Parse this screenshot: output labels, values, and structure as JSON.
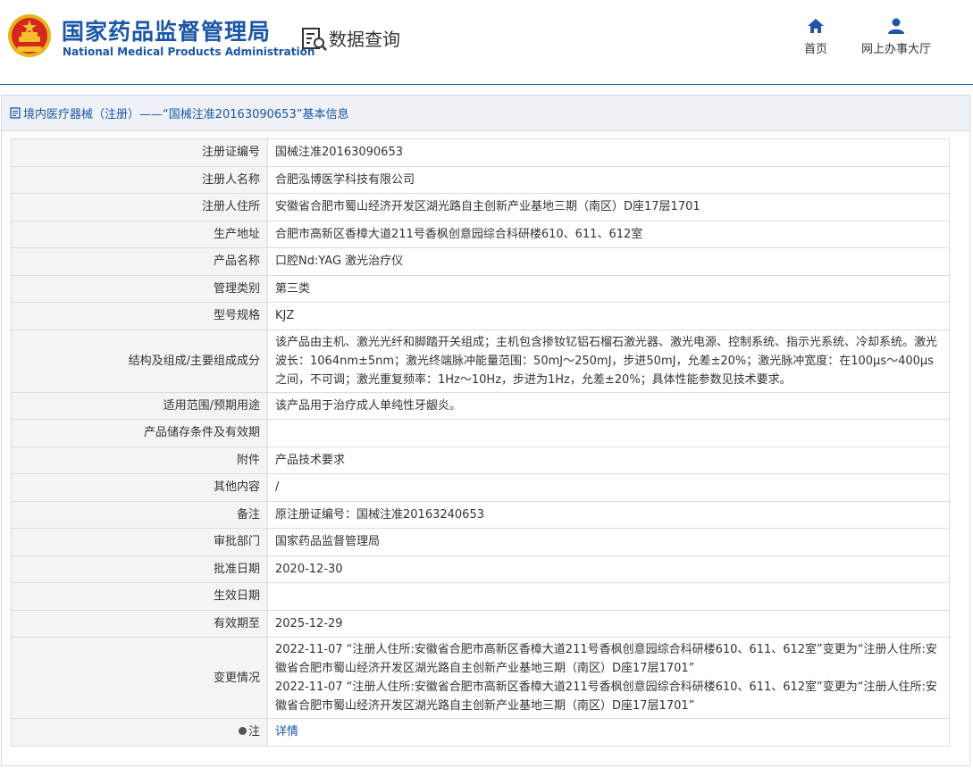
{
  "header": {
    "org_name_cn": "国家药品监督管理局",
    "org_name_en": "National Medical Products Administration",
    "page_title": "数据查询",
    "nav": [
      {
        "label": "首页",
        "icon": "home-icon"
      },
      {
        "label": "网上办事大厅",
        "icon": "user-icon"
      }
    ]
  },
  "panel": {
    "title": "境内医疗器械（注册）——“国械注准20163090653”基本信息"
  },
  "rows": [
    {
      "label": "注册证编号",
      "value": "国械注准20163090653"
    },
    {
      "label": "注册人名称",
      "value": "合肥泓博医学科技有限公司"
    },
    {
      "label": "注册人住所",
      "value": "安徽省合肥市蜀山经济开发区湖光路自主创新产业基地三期（南区）D座17层1701"
    },
    {
      "label": "生产地址",
      "value": "合肥市高新区香樟大道211号香枫创意园综合科研楼610、611、612室"
    },
    {
      "label": "产品名称",
      "value": "口腔Nd:YAG 激光治疗仪"
    },
    {
      "label": "管理类别",
      "value": "第三类"
    },
    {
      "label": "型号规格",
      "value": "KJZ"
    },
    {
      "label": "结构及组成/主要组成成分",
      "value": "该产品由主机、激光光纤和脚踏开关组成；主机包含掺钕钇铝石榴石激光器、激光电源、控制系统、指示光系统、冷却系统。激光波长：1064nm±5nm；激光终端脉冲能量范围：50mJ～250mJ，步进50mJ，允差±20%；激光脉冲宽度：在100μs～400μs之间，不可调；激光重复频率：1Hz～10Hz，步进为1Hz，允差±20%；具体性能参数见技术要求。"
    },
    {
      "label": "适用范围/预期用途",
      "value": "该产品用于治疗成人单纯性牙龈炎。"
    },
    {
      "label": "产品储存条件及有效期",
      "value": ""
    },
    {
      "label": "附件",
      "value": "产品技术要求"
    },
    {
      "label": "其他内容",
      "value": "/"
    },
    {
      "label": "备注",
      "value": "原注册证编号：国械注准20163240653"
    },
    {
      "label": "审批部门",
      "value": "国家药品监督管理局"
    },
    {
      "label": "批准日期",
      "value": "2020-12-30"
    },
    {
      "label": "生效日期",
      "value": ""
    },
    {
      "label": "有效期至",
      "value": "2025-12-29"
    }
  ],
  "changes": {
    "label": "变更情况",
    "entries": [
      "2022-11-07 “注册人住所:安徽省合肥市高新区香樟大道211号香枫创意园综合科研楼610、611、612室”变更为“注册人住所:安徽省合肥市蜀山经济开发区湖光路自主创新产业基地三期（南区）D座17层1701”",
      "2022-11-07 “注册人住所:安徽省合肥市高新区香樟大道211号香枫创意园综合科研楼610、611、612室”变更为“注册人住所:安徽省合肥市蜀山经济开发区湖光路自主创新产业基地三期（南区）D座17层1701”"
    ]
  },
  "note": {
    "label": "注",
    "icon": "bulb-icon",
    "link_text": "详情"
  },
  "colors": {
    "brand_blue": "#1b56a8",
    "label_bg": "#f4f4f4",
    "header_bg": "#eef1f6"
  }
}
